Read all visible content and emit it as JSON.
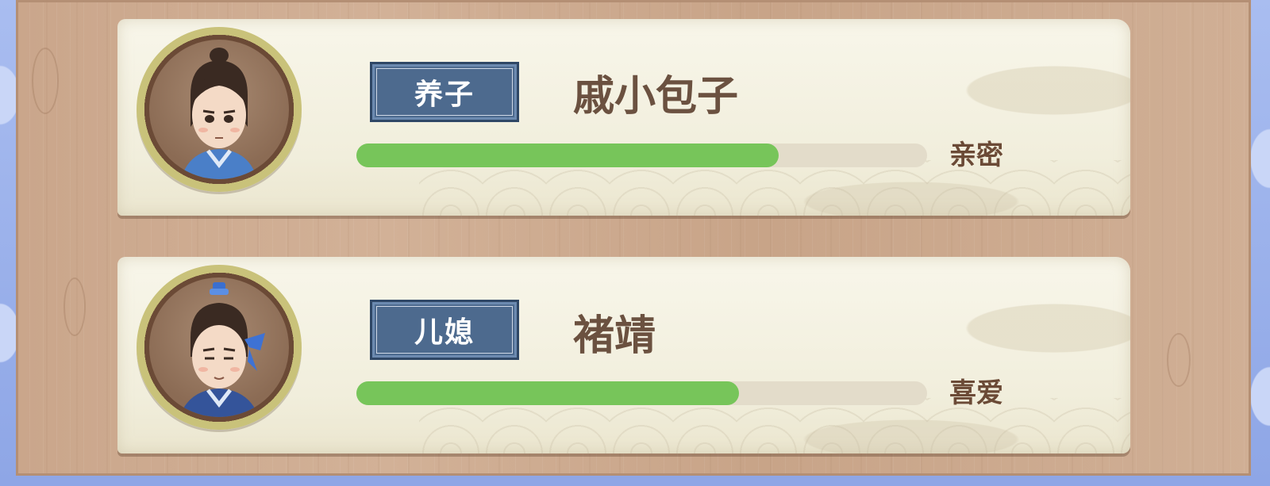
{
  "members": [
    {
      "role": "养子",
      "name": "戚小包子",
      "relationship": "亲密",
      "affection": 0.74,
      "avatar_icon": "male-youth-topknot-portrait-icon"
    },
    {
      "role": "儿媳",
      "name": "褚靖",
      "relationship": "喜爱",
      "affection": 0.67,
      "avatar_icon": "male-youth-blue-ribbon-portrait-icon"
    }
  ],
  "colors": {
    "bar_fill": "#77c55a",
    "bar_track": "#e3dcca",
    "tag_bg": "#4d6a8e",
    "name_text": "#6b5140"
  }
}
